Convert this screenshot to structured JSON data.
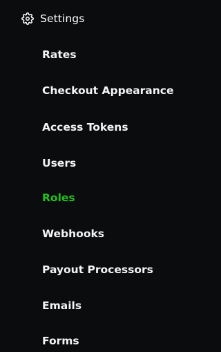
{
  "section": {
    "label": "Settings",
    "icon": "gear-icon"
  },
  "menu": {
    "items": [
      {
        "label": "Rates",
        "active": false
      },
      {
        "label": "Checkout Appearance",
        "active": false
      },
      {
        "label": "Access Tokens",
        "active": false
      },
      {
        "label": "Users",
        "active": false
      },
      {
        "label": "Roles",
        "active": true
      },
      {
        "label": "Webhooks",
        "active": false
      },
      {
        "label": "Payout Processors",
        "active": false
      },
      {
        "label": "Emails",
        "active": false
      },
      {
        "label": "Forms",
        "active": false
      }
    ]
  },
  "colors": {
    "background": "#0b0c0e",
    "text": "#ffffff",
    "active": "#22c21d"
  }
}
